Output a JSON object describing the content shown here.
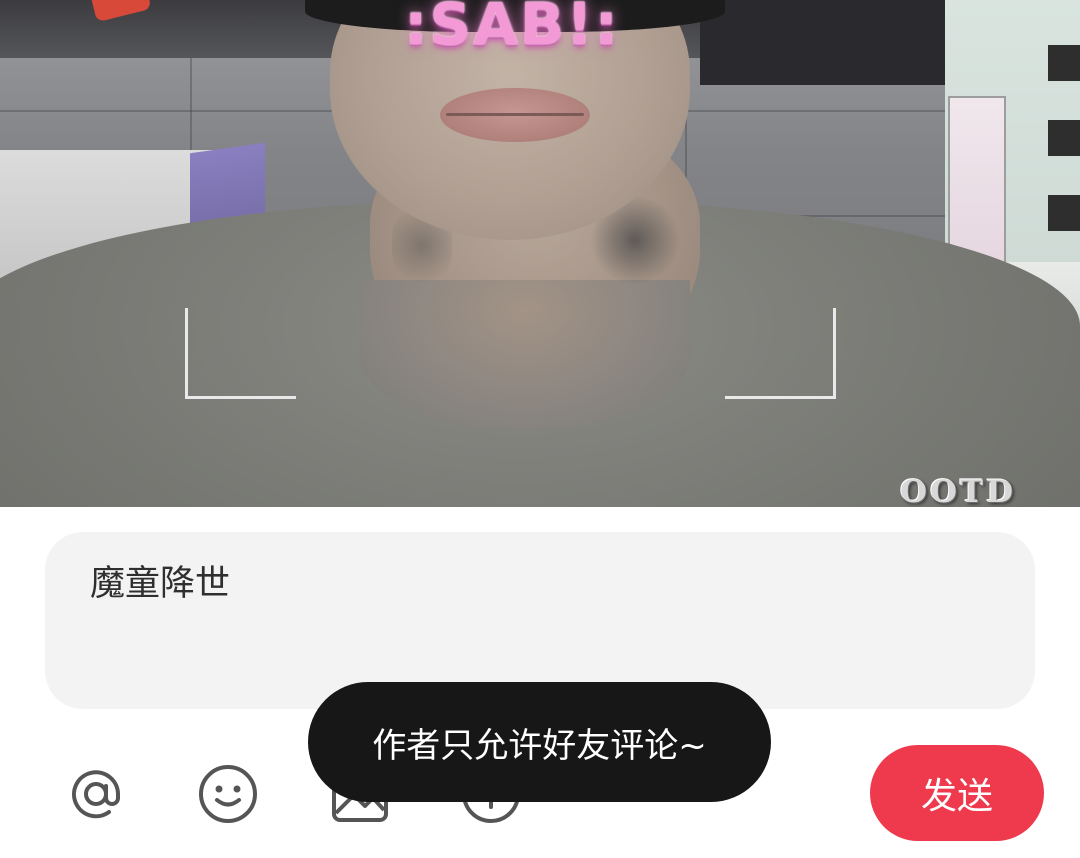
{
  "photo": {
    "sticker_text": ":SAB!:",
    "watermark_text": "OOTD"
  },
  "comment": {
    "text": "魔童降世"
  },
  "toolbar": {
    "icons": [
      "at-icon",
      "emoji-icon",
      "image-icon",
      "plus-icon"
    ],
    "send_label": "发送",
    "send_color": "#ef3a4e"
  },
  "toast": {
    "message": "作者只允许好友评论~"
  }
}
